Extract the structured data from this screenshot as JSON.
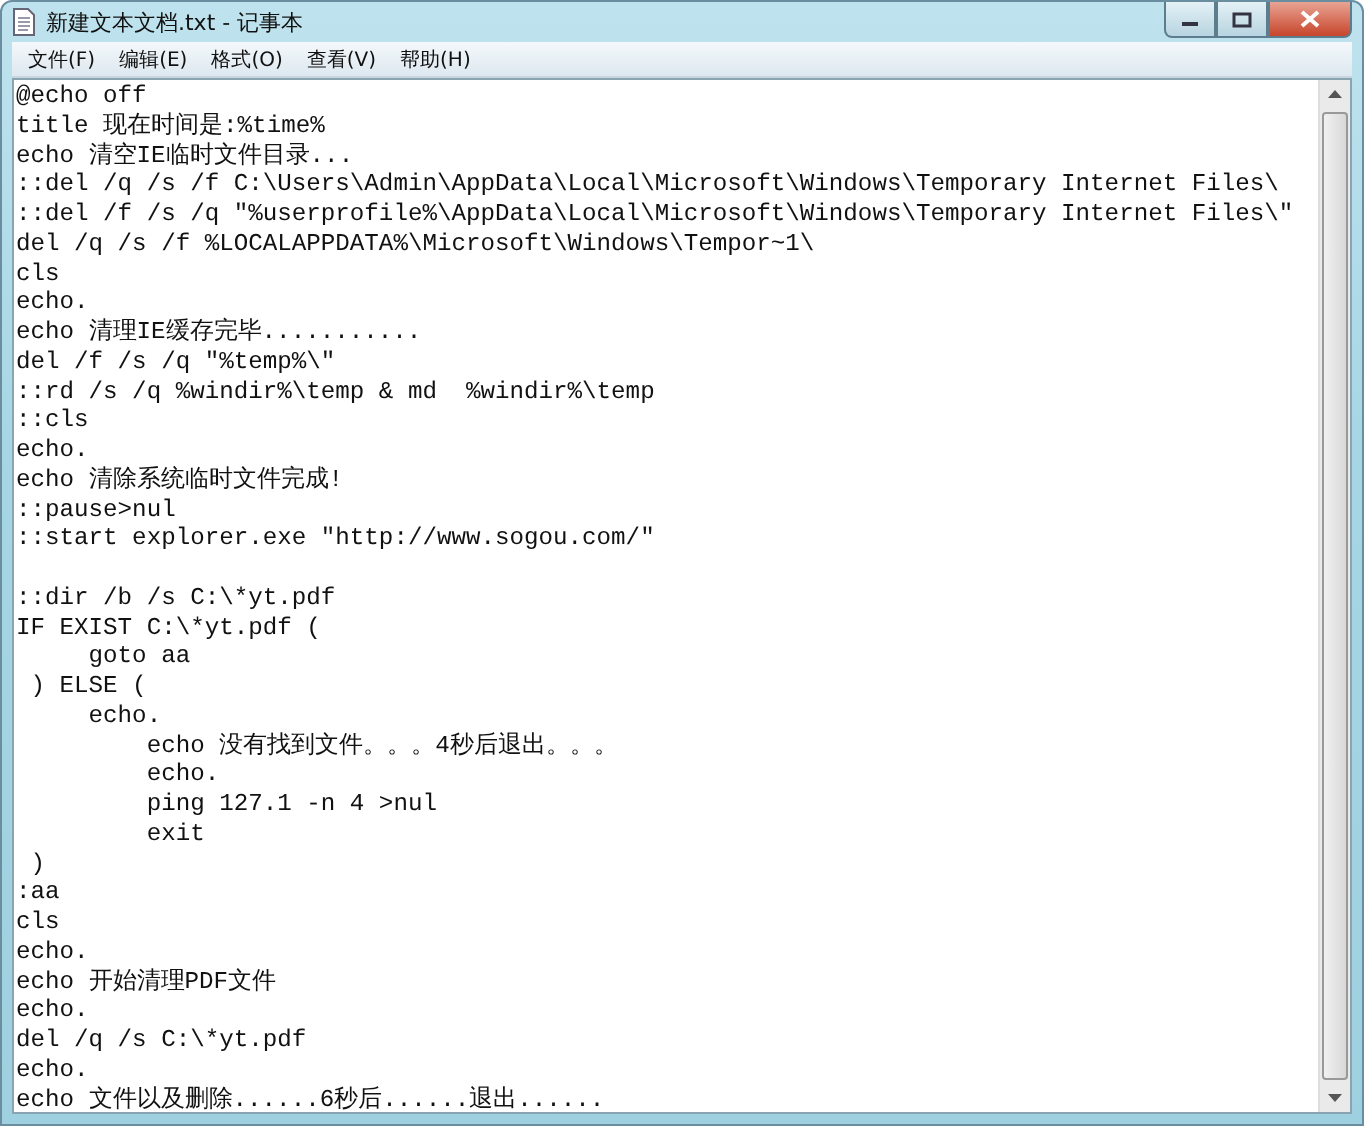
{
  "window": {
    "title": "新建文本文档.txt - 记事本"
  },
  "menu": [
    "文件(F)",
    "编辑(E)",
    "格式(O)",
    "查看(V)",
    "帮助(H)"
  ],
  "document": {
    "content": "@echo off\ntitle 现在时间是:%time%\necho 清空IE临时文件目录...\n::del /q /s /f C:\\Users\\Admin\\AppData\\Local\\Microsoft\\Windows\\Temporary Internet Files\\\n::del /f /s /q \"%userprofile%\\AppData\\Local\\Microsoft\\Windows\\Temporary Internet Files\\\"\ndel /q /s /f %LOCALAPPDATA%\\Microsoft\\Windows\\Tempor~1\\\ncls\necho.\necho 清理IE缓存完毕...........\ndel /f /s /q \"%temp%\\\"\n::rd /s /q %windir%\\temp & md  %windir%\\temp\n::cls\necho.\necho 清除系统临时文件完成!\n::pause>nul\n::start explorer.exe \"http://www.sogou.com/\"\n\n::dir /b /s C:\\*yt.pdf\nIF EXIST C:\\*yt.pdf (\n     goto aa\n ) ELSE (\n     echo.\n         echo 没有找到文件。。。4秒后退出。。。\n         echo.\n         ping 127.1 -n 4 >nul\n         exit\n )\n:aa\ncls\necho.\necho 开始清理PDF文件\necho.\ndel /q /s C:\\*yt.pdf\necho.\necho 文件以及删除......6秒后......退出......"
  }
}
